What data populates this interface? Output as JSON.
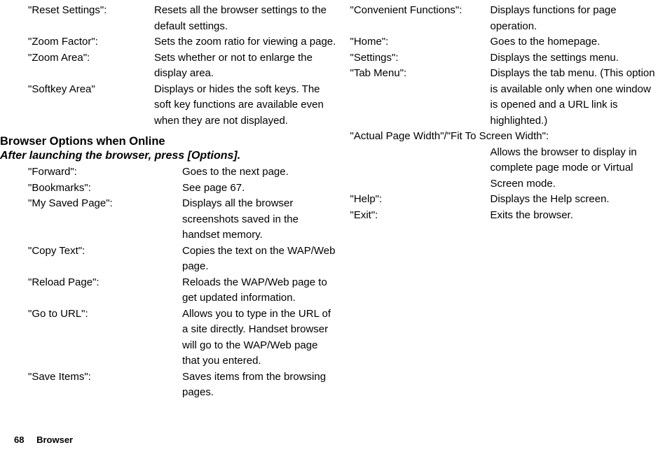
{
  "leftColumn": {
    "top": [
      {
        "term": "\"Reset Settings\":",
        "desc": "Resets all the browser settings to the default settings."
      },
      {
        "term": "\"Zoom Factor\":",
        "desc": "Sets the zoom ratio for viewing a page."
      },
      {
        "term": "\"Zoom Area\":",
        "desc": "Sets whether or not to enlarge the display area."
      },
      {
        "term": "\"Softkey Area\"",
        "desc": "Displays or hides the soft keys. The soft key functions are available even when they are not displayed."
      }
    ],
    "heading": "Browser Options when Online",
    "subheading": "After launching the browser, press [Options].",
    "bottom": [
      {
        "term": "\"Forward\":",
        "desc": "Goes to the next page."
      },
      {
        "term": "\"Bookmarks\":",
        "desc": "See page 67."
      },
      {
        "term": "\"My Saved Page\":",
        "desc": "Displays all the browser screenshots saved in the handset memory."
      },
      {
        "term": "\"Copy Text\":",
        "desc": "Copies the text on the WAP/Web page."
      },
      {
        "term": "\"Reload Page\":",
        "desc": "Reloads the WAP/Web page to get updated information."
      },
      {
        "term": "\"Go to URL\":",
        "desc": "Allows you to type in the URL of a site directly. Handset browser will go to the WAP/Web page that you entered."
      },
      {
        "term": "\"Save Items\":",
        "desc": "Saves items from the browsing pages."
      }
    ]
  },
  "rightColumn": {
    "items": [
      {
        "term": "\"Convenient Functions\":",
        "desc": "Displays functions for page operation."
      },
      {
        "term": "\"Home\":",
        "desc": "Goes to the homepage."
      },
      {
        "term": "\"Settings\":",
        "desc": "Displays the settings menu."
      },
      {
        "term": "\"Tab Menu\":",
        "desc": "Displays the tab menu. (This option is available only when one window is opened and a URL link is highlighted.)"
      }
    ],
    "full": {
      "term": "\"Actual Page Width\"/\"Fit To Screen Width\":",
      "desc": "Allows the browser to display in complete page mode or Virtual Screen mode."
    },
    "items2": [
      {
        "term": "\"Help\":",
        "desc": "Displays the Help screen."
      },
      {
        "term": "\"Exit\":",
        "desc": "Exits the browser."
      }
    ]
  },
  "footer": {
    "page": "68",
    "section": "Browser"
  }
}
